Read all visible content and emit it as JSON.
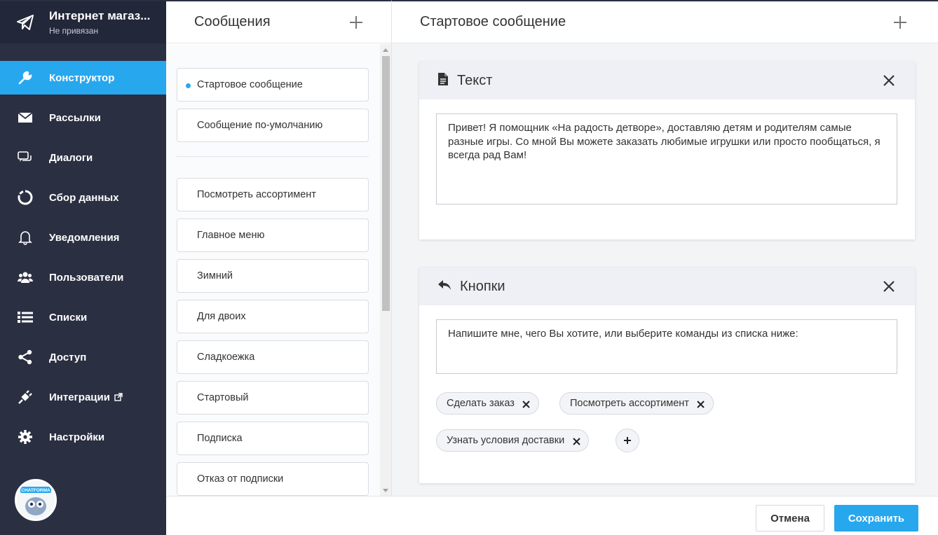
{
  "brand": {
    "title": "Интернет магаз...",
    "subtitle": "Не привязан"
  },
  "nav": [
    {
      "label": "Конструктор",
      "icon": "wrench-icon",
      "active": true
    },
    {
      "label": "Рассылки",
      "icon": "envelope-icon"
    },
    {
      "label": "Диалоги",
      "icon": "chat-icon"
    },
    {
      "label": "Сбор данных",
      "icon": "circle-chart-icon"
    },
    {
      "label": "Уведомления",
      "icon": "bell-icon"
    },
    {
      "label": "Пользователи",
      "icon": "users-icon"
    },
    {
      "label": "Списки",
      "icon": "list-icon"
    },
    {
      "label": "Доступ",
      "icon": "share-icon"
    },
    {
      "label": "Интеграции",
      "icon": "plug-icon"
    },
    {
      "label": "Настройки",
      "icon": "gear-icon"
    }
  ],
  "avatar_label": "CHATFORMA",
  "messages_panel": {
    "title": "Сообщения",
    "pinned": [
      "Стартовое сообщение",
      "Сообщение по-умолчанию"
    ],
    "items": [
      "Посмотреть ассортимент",
      "Главное меню",
      "Зимний",
      "Для двоих",
      "Сладкоежка",
      "Стартовый",
      "Подписка",
      "Отказ от подписки"
    ]
  },
  "editor": {
    "title": "Стартовое сообщение",
    "text_card": {
      "title": "Текст",
      "content": "Привет! Я помощник «На радость детворе», доставляю детям и родителям самые разные игры. Со мной Вы можете заказать любимые игрушки или просто пообщаться, я всегда рад Вам!"
    },
    "buttons_card": {
      "title": "Кнопки",
      "content": "Напишите мне, чего Вы хотите, или выберите команды из списка ниже:",
      "chips": [
        "Сделать заказ",
        "Посмотреть ассортимент",
        "Узнать условия доставки"
      ]
    }
  },
  "footer": {
    "cancel": "Отмена",
    "save": "Сохранить"
  },
  "colors": {
    "accent": "#27a7ee",
    "sidebar": "#2b2f42"
  }
}
